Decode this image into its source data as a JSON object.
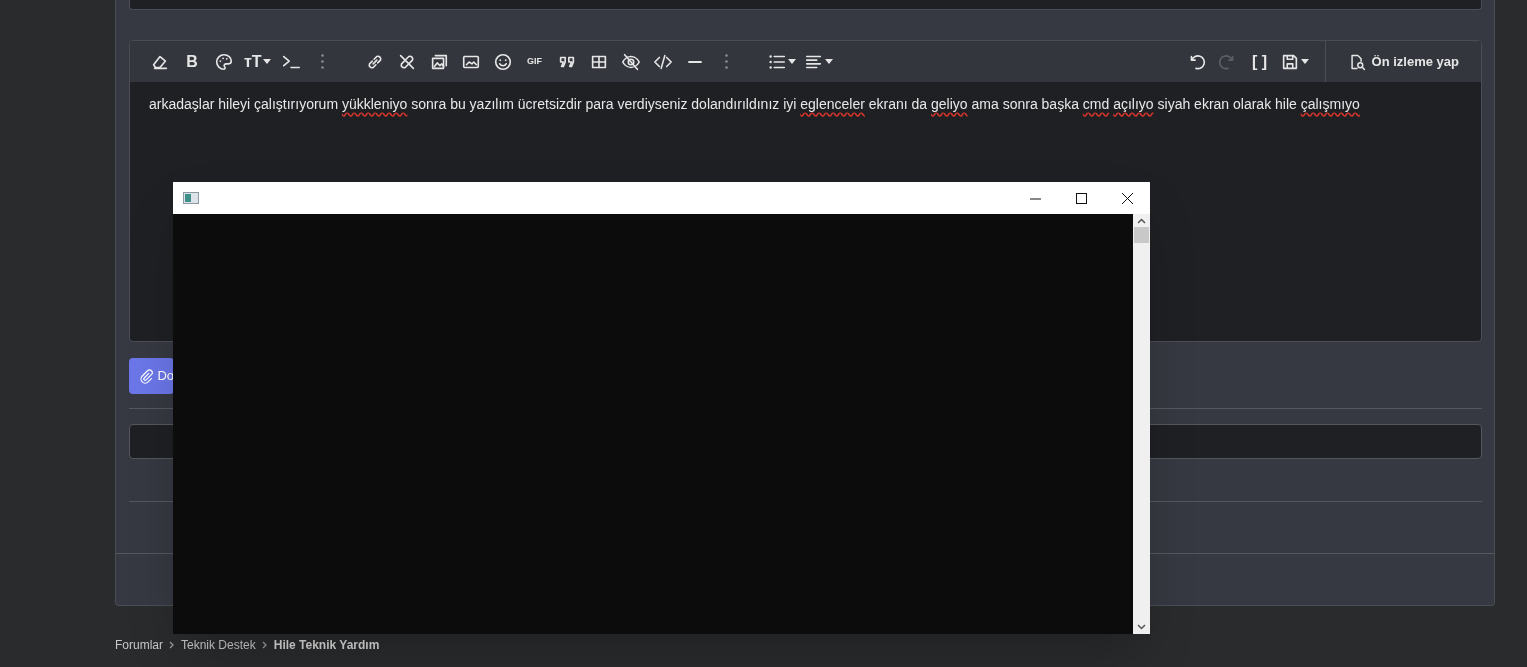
{
  "editor": {
    "toolbar_left": [
      {
        "kind": "eraser",
        "has_menu": false
      },
      {
        "kind": "glyph",
        "glyph": "B",
        "has_menu": false
      },
      {
        "kind": "palette",
        "has_menu": false
      },
      {
        "kind": "glyph",
        "glyph": "тT",
        "has_menu": true
      },
      {
        "kind": "terminal",
        "has_menu": false
      },
      {
        "kind": "more",
        "has_menu": false
      },
      {
        "kind": "spacer"
      },
      {
        "kind": "link",
        "has_menu": false
      },
      {
        "kind": "unlink",
        "has_menu": false
      },
      {
        "kind": "media",
        "has_menu": false
      },
      {
        "kind": "image",
        "has_menu": false
      },
      {
        "kind": "smiley",
        "has_menu": false
      },
      {
        "kind": "glyph",
        "glyph": "GIF",
        "has_menu": false
      },
      {
        "kind": "quote",
        "has_menu": false
      },
      {
        "kind": "table",
        "has_menu": false
      },
      {
        "kind": "hidden",
        "has_menu": false
      },
      {
        "kind": "code",
        "has_menu": false
      },
      {
        "kind": "rule",
        "has_menu": false
      },
      {
        "kind": "more",
        "has_menu": false
      },
      {
        "kind": "spacer"
      },
      {
        "kind": "list",
        "has_menu": true
      },
      {
        "kind": "align",
        "has_menu": true
      }
    ],
    "toolbar_right": [
      {
        "kind": "undo",
        "has_menu": false,
        "disabled": false
      },
      {
        "kind": "redo",
        "has_menu": false,
        "disabled": true
      },
      {
        "kind": "glyph",
        "glyph": "[ ]",
        "has_menu": false,
        "disabled": false
      },
      {
        "kind": "save",
        "has_menu": true,
        "disabled": false
      }
    ],
    "preview_button": "Ön izleme yap",
    "text_segments": [
      {
        "text": "arkadaşlar hileyi çalıştırıyorum",
        "misspelled": false
      },
      {
        "text": "yükkleniyo",
        "misspelled": true
      },
      {
        "text": "sonra bu yazılım ücretsizdir para verdiyseniz dolandırıldınız iyi",
        "misspelled": false
      },
      {
        "text": "eglenceler",
        "misspelled": true
      },
      {
        "text": "ekranı da",
        "misspelled": false
      },
      {
        "text": "geliyo",
        "misspelled": true
      },
      {
        "text": "ama sonra başka",
        "misspelled": false
      },
      {
        "text": "cmd",
        "misspelled": true
      },
      {
        "text": "açılıyo",
        "misspelled": true
      },
      {
        "text": "siyah ekran olarak hile",
        "misspelled": false
      },
      {
        "text": "çalışmıyo",
        "misspelled": true
      }
    ]
  },
  "attach_button": "Do",
  "breadcrumb": [
    {
      "label": "Forumlar",
      "current": false
    },
    {
      "label": "Teknik Destek",
      "current": false
    },
    {
      "label": "Hile Teknik Yardım",
      "current": true
    }
  ],
  "console_window": {
    "kind": "console"
  }
}
